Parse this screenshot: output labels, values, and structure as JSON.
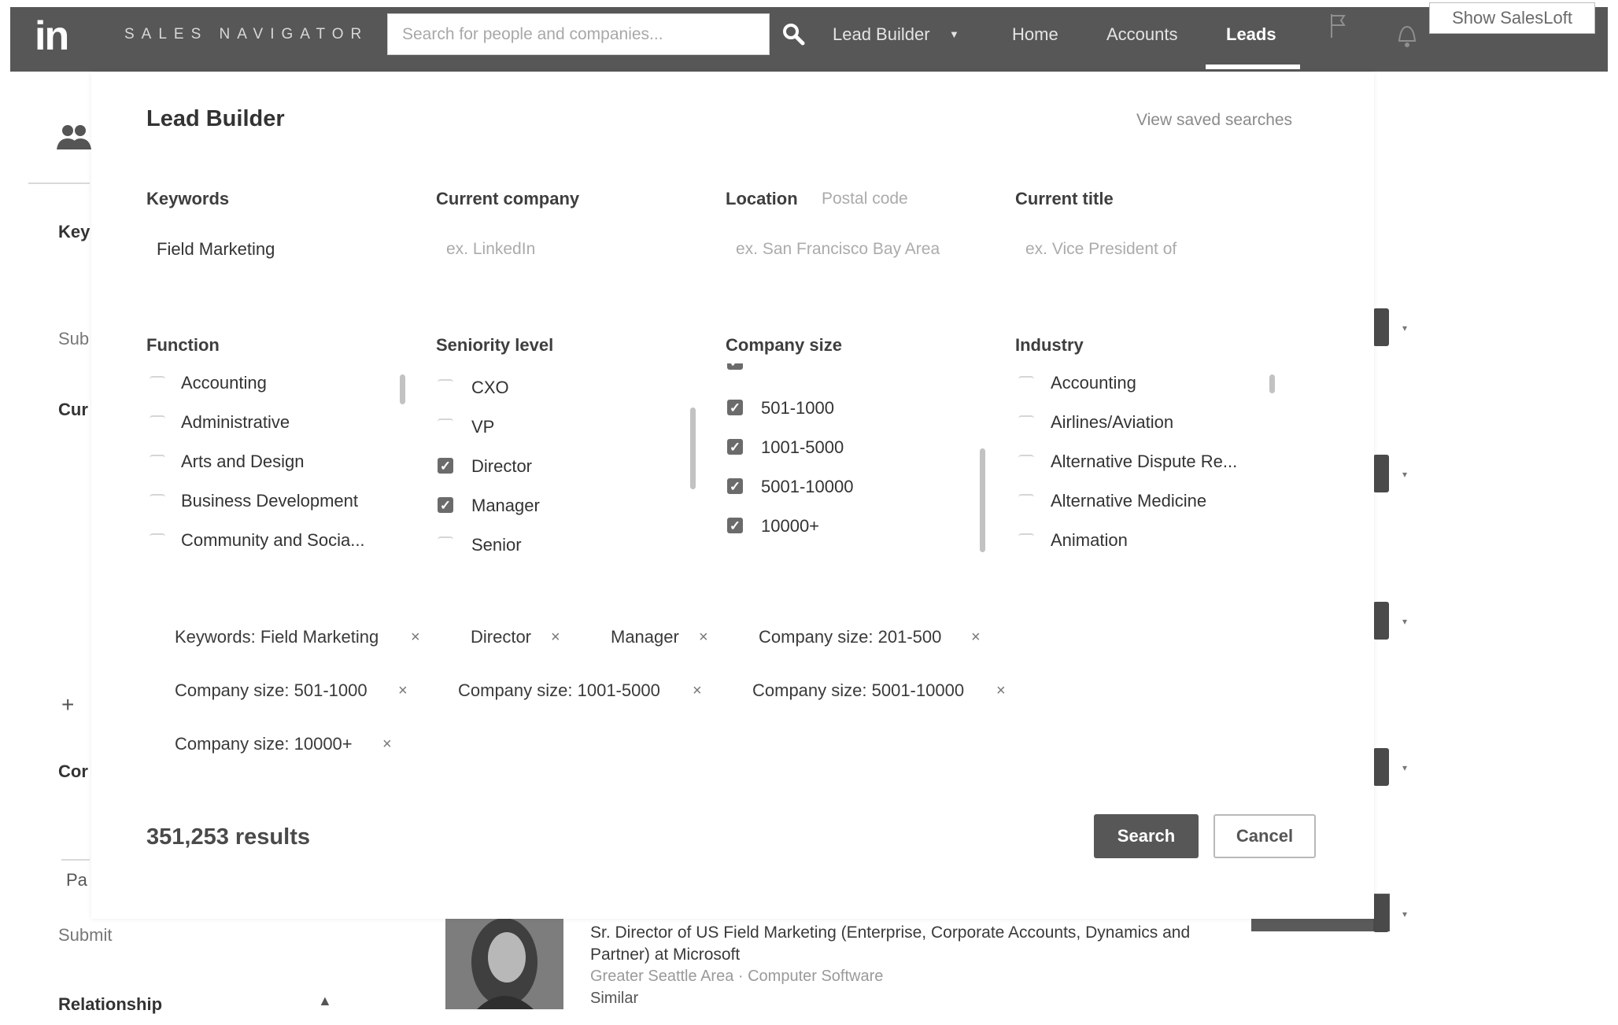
{
  "nav": {
    "logo": "in",
    "brand": "SALES NAVIGATOR",
    "search_placeholder": "Search for people and companies...",
    "lead_builder": "Lead Builder",
    "home": "Home",
    "accounts": "Accounts",
    "leads": "Leads",
    "show_salesloft": "Show SalesLoft"
  },
  "background": {
    "key": "Key",
    "sub": "Sub",
    "cur": "Cur",
    "plus": "+",
    "cor": "Cor",
    "pa": "Pa",
    "submit": "Submit",
    "relationship": "Relationship",
    "lead": {
      "headline": "Sr. Director of US Field Marketing (Enterprise, Corporate Accounts, Dynamics and Partner) at Microsoft",
      "location": "Greater Seattle Area · Computer Software",
      "similar": "Similar"
    }
  },
  "modal": {
    "title": "Lead Builder",
    "view_saved": "View saved searches",
    "keywords": {
      "label": "Keywords",
      "value": "Field Marketing"
    },
    "current_company": {
      "label": "Current company",
      "placeholder": "ex. LinkedIn"
    },
    "location": {
      "label": "Location",
      "postal": "Postal code",
      "placeholder": "ex. San Francisco Bay Area"
    },
    "current_title": {
      "label": "Current title",
      "placeholder": "ex. Vice President of"
    },
    "function": {
      "label": "Function",
      "options": [
        "Accounting",
        "Administrative",
        "Arts and Design",
        "Business Development",
        "Community and Socia..."
      ]
    },
    "seniority": {
      "label": "Seniority level",
      "options": [
        "CXO",
        "VP",
        "Director",
        "Manager",
        "Senior"
      ]
    },
    "company_size": {
      "label": "Company size",
      "options": [
        "501-1000",
        "1001-5000",
        "5001-10000",
        "10000+"
      ]
    },
    "industry": {
      "label": "Industry",
      "options": [
        "Accounting",
        "Airlines/Aviation",
        "Alternative Dispute Re...",
        "Alternative Medicine",
        "Animation"
      ]
    },
    "filters": [
      "Keywords: Field Marketing",
      "Director",
      "Manager",
      "Company size: 201-500",
      "Company size: 501-1000",
      "Company size: 1001-5000",
      "Company size: 5001-10000",
      "Company size: 10000+"
    ],
    "remove_symbol": "×",
    "results": "351,253 results",
    "search_button": "Search",
    "cancel_button": "Cancel"
  }
}
